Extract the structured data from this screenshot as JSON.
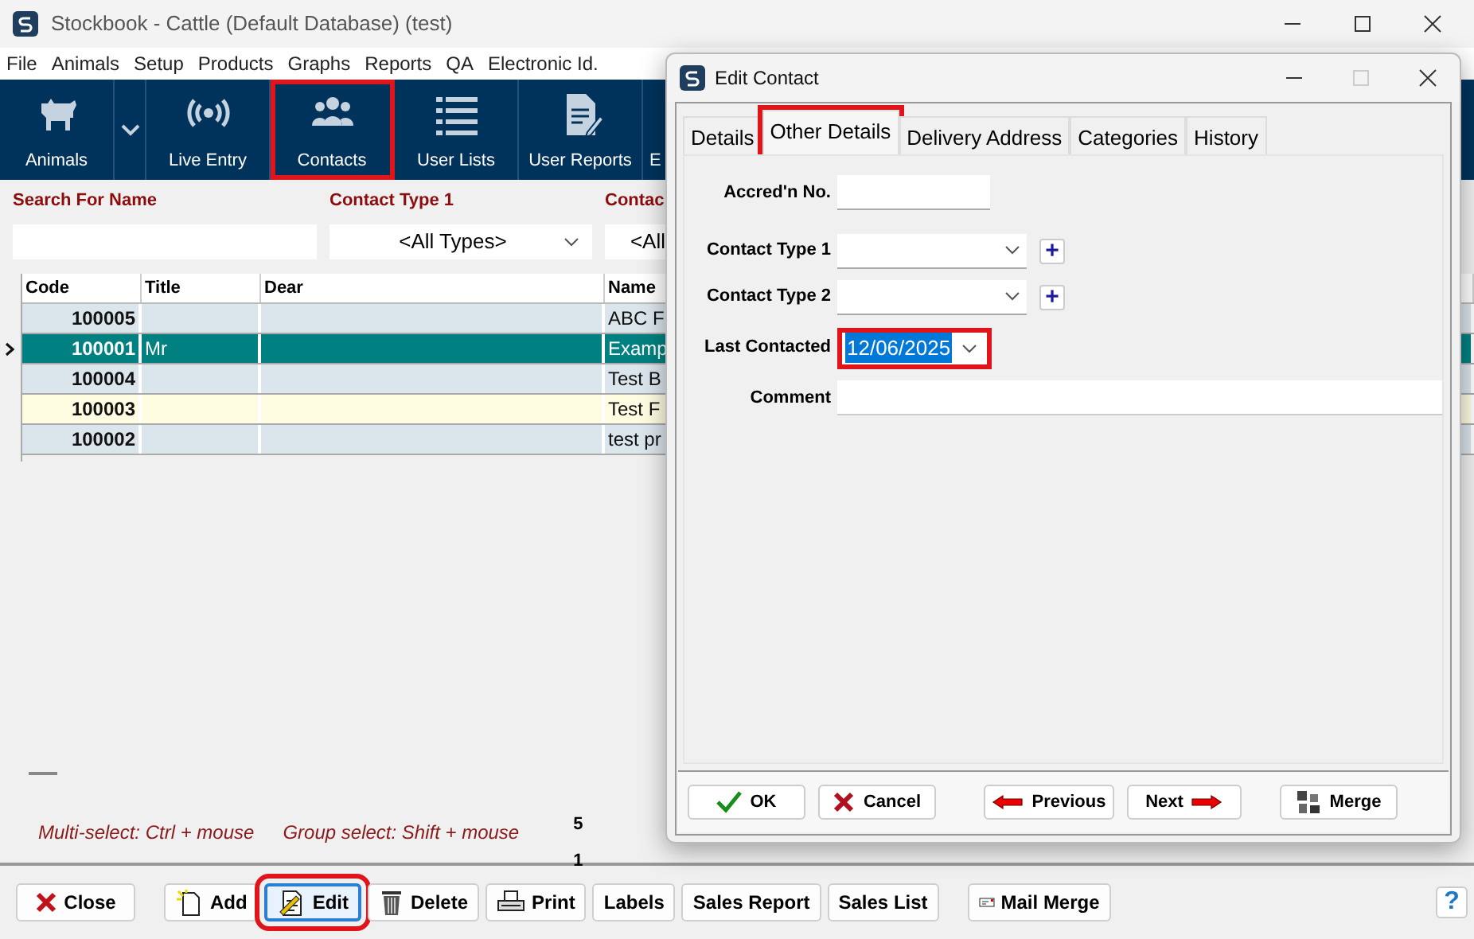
{
  "window": {
    "title": "Stockbook - Cattle (Default Database) (test)"
  },
  "menu": [
    "File",
    "Animals",
    "Setup",
    "Products",
    "Graphs",
    "Reports",
    "QA",
    "Electronic Id."
  ],
  "toolbar": [
    {
      "kind": "animals",
      "label": "Animals",
      "highlighted": false
    },
    {
      "kind": "live",
      "label": "Live Entry",
      "highlighted": false
    },
    {
      "kind": "contacts",
      "label": "Contacts",
      "highlighted": true
    },
    {
      "kind": "lists",
      "label": "User Lists",
      "highlighted": false
    },
    {
      "kind": "reports",
      "label": "User Reports",
      "highlighted": false
    },
    {
      "kind": "cut",
      "label": "E",
      "highlighted": false
    }
  ],
  "filters": [
    {
      "kind": "text",
      "label": "Search For Name"
    },
    {
      "kind": "select",
      "label": "Contact Type 1",
      "value": "<All Types>"
    },
    {
      "kind": "select",
      "label": "Contac",
      "value": "<All"
    }
  ],
  "table": {
    "columns": [
      "Code",
      "Title",
      "Dear",
      "Name"
    ],
    "rows": [
      {
        "code": "100005",
        "name": "ABC F",
        "selected": false,
        "color": "#dbe5ec"
      },
      {
        "code": "100001",
        "title": "Mr",
        "name": "Examp",
        "selected": true
      },
      {
        "code": "100004",
        "name": "Test B",
        "selected": false,
        "color": "#dbe5ec"
      },
      {
        "code": "100003",
        "name": "Test F",
        "selected": false,
        "color": "#fffde1"
      },
      {
        "code": "100002",
        "name": "test pr",
        "selected": false,
        "color": "#dbe5ec"
      }
    ]
  },
  "hints": [
    "Multi-select: Ctrl + mouse",
    "Group select: Shift + mouse"
  ],
  "counts": [
    "5",
    "1"
  ],
  "buttons": [
    {
      "kind": "close",
      "label": "Close",
      "highlighted": false
    },
    {
      "kind": "add",
      "label": "Add",
      "highlighted": false
    },
    {
      "kind": "edit",
      "label": "Edit",
      "highlighted": true
    },
    {
      "kind": "delete",
      "label": "Delete",
      "highlighted": false
    },
    {
      "kind": "print",
      "label": "Print",
      "highlighted": false
    },
    {
      "kind": "plain",
      "label": "Labels",
      "highlighted": false
    },
    {
      "kind": "plain",
      "label": "Sales Report",
      "highlighted": false
    },
    {
      "kind": "plain",
      "label": "Sales List",
      "highlighted": false
    },
    {
      "kind": "mail",
      "label": "Mail Merge",
      "highlighted": false
    }
  ],
  "help": "?",
  "dialog": {
    "title": "Edit Contact",
    "tabs": [
      {
        "label": "Details",
        "selected": false,
        "highlighted": false
      },
      {
        "label": "Other Details",
        "selected": true,
        "highlighted": true
      },
      {
        "label": "Delivery Address",
        "selected": false,
        "highlighted": false
      },
      {
        "label": "Categories",
        "selected": false,
        "highlighted": false
      },
      {
        "label": "History",
        "selected": false,
        "highlighted": false
      }
    ],
    "fields": [
      {
        "kind": "text",
        "label": "Accred'n No.",
        "highlighted": false
      },
      {
        "kind": "select",
        "label": "Contact Type 1",
        "add": "+",
        "highlighted": false
      },
      {
        "kind": "select",
        "label": "Contact Type 2",
        "add": "+",
        "highlighted": false
      },
      {
        "kind": "date",
        "label": "Last Contacted",
        "value": "12/06/2025",
        "highlighted": true
      },
      {
        "kind": "wide",
        "label": "Comment",
        "highlighted": false
      }
    ],
    "buttons": [
      {
        "kind": "ok",
        "label": "OK"
      },
      {
        "kind": "cancel",
        "label": "Cancel"
      },
      {
        "kind": "previous",
        "label": "Previous"
      },
      {
        "kind": "next",
        "label": "Next"
      },
      {
        "kind": "merge",
        "label": "Merge"
      }
    ]
  }
}
